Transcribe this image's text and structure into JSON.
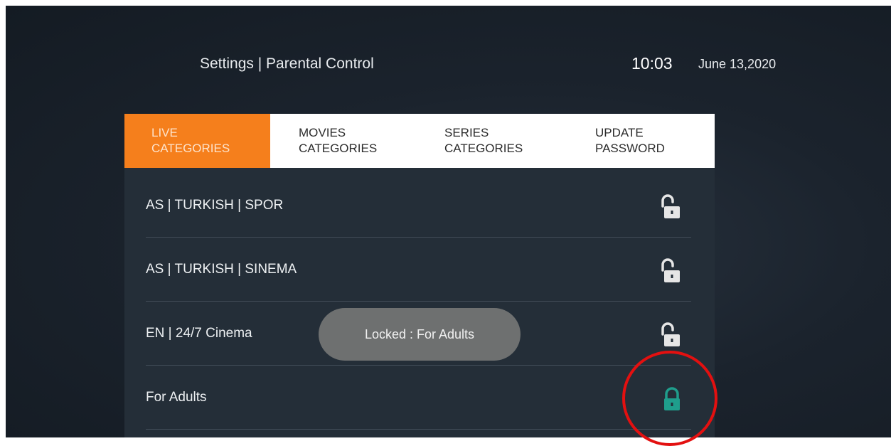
{
  "header": {
    "title": "Settings  |  Parental Control",
    "time": "10:03",
    "date": "June 13,2020"
  },
  "tabs": [
    {
      "line1": "LIVE",
      "line2": "CATEGORIES",
      "active": true
    },
    {
      "line1": "MOVIES",
      "line2": "CATEGORIES",
      "active": false
    },
    {
      "line1": "SERIES",
      "line2": "CATEGORIES",
      "active": false
    },
    {
      "line1": "UPDATE",
      "line2": "PASSWORD",
      "active": false
    }
  ],
  "categories": [
    {
      "label": "AS | TURKISH | SPOR",
      "lock_state": "unlocked",
      "icon": "unlocked-padlock-icon"
    },
    {
      "label": "AS | TURKISH | SINEMA",
      "lock_state": "unlocked",
      "icon": "unlocked-padlock-icon"
    },
    {
      "label": "EN | 24/7 Cinema",
      "lock_state": "unlocked",
      "icon": "unlocked-padlock-icon"
    },
    {
      "label": "For Adults",
      "lock_state": "locked",
      "icon": "locked-padlock-icon"
    }
  ],
  "toast": {
    "text": "Locked : For Adults"
  },
  "colors": {
    "accent": "#f57f1c",
    "locked": "#1f9e8c",
    "unlocked": "#e6e6e6",
    "annotation": "#e31010"
  }
}
